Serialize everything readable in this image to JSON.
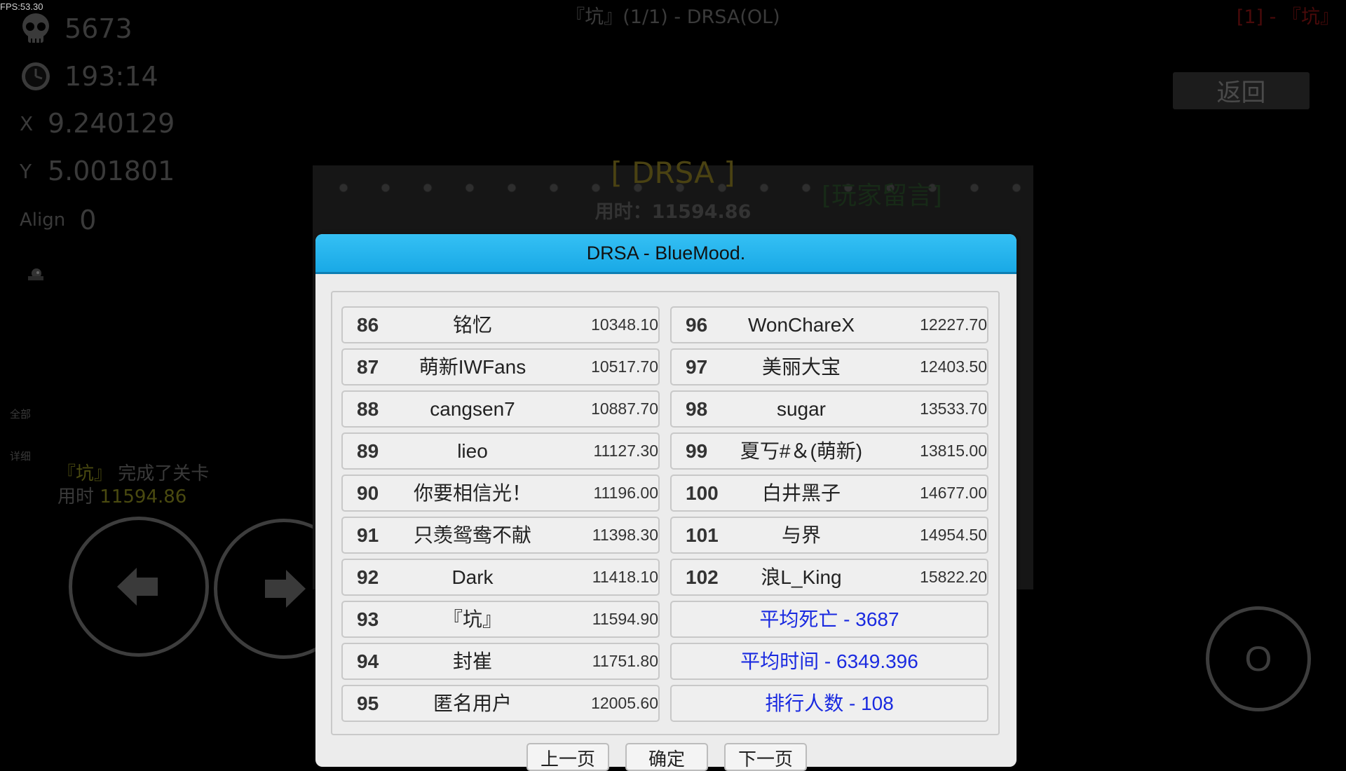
{
  "hud": {
    "fps": "FPS:53.30",
    "level_title": "『坑』(1/1) - DRSA(OL)",
    "player_tag": "[1] - 『坑』",
    "deaths": "5673",
    "time": "193:14",
    "x_label": "X",
    "x_value": "9.240129",
    "y_label": "Y",
    "y_value": "5.001801",
    "align_label": "Align",
    "align_value": "0",
    "back_label": "返回",
    "side_all": "全部",
    "side_detail": "详细",
    "completion_player": "『坑』",
    "completion_text": "完成了关卡",
    "completion_time_label": "用时",
    "completion_time_value": "11594.86",
    "jump_label": "O"
  },
  "background_panel": {
    "title": "[ DRSA ]",
    "time_line": "用时：11594.86",
    "stamp": "[玩家留言]"
  },
  "dialog": {
    "title": "DRSA - BlueMood.",
    "left_rows": [
      {
        "rank": "86",
        "name": "铭忆",
        "time": "10348.10"
      },
      {
        "rank": "87",
        "name": "萌新IWFans",
        "time": "10517.70"
      },
      {
        "rank": "88",
        "name": "cangsen7",
        "time": "10887.70"
      },
      {
        "rank": "89",
        "name": "lieo",
        "time": "11127.30"
      },
      {
        "rank": "90",
        "name": "你要相信光！",
        "time": "11196.00"
      },
      {
        "rank": "91",
        "name": "只羡鸳鸯不献血",
        "time": "11398.30"
      },
      {
        "rank": "92",
        "name": "Dark",
        "time": "11418.10"
      },
      {
        "rank": "93",
        "name": "『坑』",
        "time": "11594.90"
      },
      {
        "rank": "94",
        "name": "封崔",
        "time": "11751.80"
      },
      {
        "rank": "95",
        "name": "匿名用户",
        "time": "12005.60"
      }
    ],
    "right_rows": [
      {
        "rank": "96",
        "name": "WonChareX",
        "time": "12227.70"
      },
      {
        "rank": "97",
        "name": "美丽大宝",
        "time": "12403.50"
      },
      {
        "rank": "98",
        "name": "sugar",
        "time": "13533.70"
      },
      {
        "rank": "99",
        "name": "夏丂#＆(萌新)",
        "time": "13815.00"
      },
      {
        "rank": "100",
        "name": "白井黑子",
        "time": "14677.00"
      },
      {
        "rank": "101",
        "name": "与界",
        "time": "14954.50"
      },
      {
        "rank": "102",
        "name": "浪L_King",
        "time": "15822.20"
      }
    ],
    "summary": {
      "avg_deaths": "平均死亡 - 3687",
      "avg_time": "平均时间 - 6349.396",
      "rank_count": "排行人数 - 108"
    },
    "buttons": {
      "prev": "上一页",
      "confirm": "确定",
      "next": "下一页"
    }
  },
  "colors": {
    "dialog_header": "#1fb2ee",
    "summary_text": "#1a2ae0",
    "player_tag": "#4a0a0a"
  },
  "icons": [
    "skull-icon",
    "clock-icon",
    "arrow-left-icon",
    "arrow-right-icon"
  ]
}
